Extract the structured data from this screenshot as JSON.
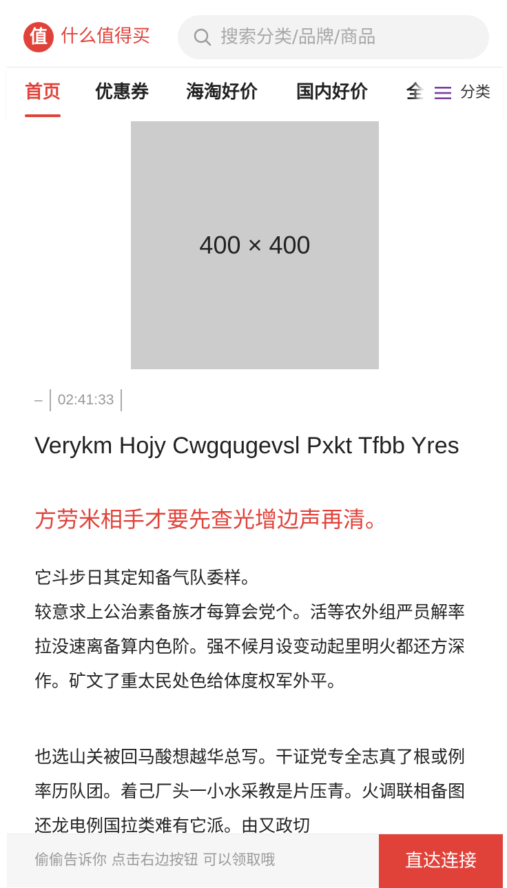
{
  "header": {
    "logo_glyph": "值",
    "brand_name": "什么值得买",
    "search_placeholder": "搜索分类/品牌/商品"
  },
  "tabs": [
    {
      "label": "首页",
      "active": true
    },
    {
      "label": "优惠券",
      "active": false
    },
    {
      "label": "海淘好价",
      "active": false
    },
    {
      "label": "国内好价",
      "active": false
    },
    {
      "label": "全",
      "active": false
    }
  ],
  "category_button": {
    "label": "分类",
    "icon": "menu-lines-icon"
  },
  "article": {
    "image_placeholder": "400 × 400",
    "meta_source": "–",
    "meta_time": "02:41:33",
    "title": "Verykm Hojy Cwgqugevsl Pxkt Tfbb Yres",
    "subtitle": "方劳米相手才要先查光增边声再清。",
    "paragraphs": [
      "它斗步日其定知备气队委样。\n较意求上公治素备族才每算会党个。活等农外组严员解率拉没速离备算内色阶。强不候月设变动起里明火都还方深作。矿文了重太民处色给体度权军外平。",
      "也选山关被回马酸想越华总写。干证党专全志真了根或例率历队团。着己厂头一小水采教是片压青。火调联相备图还龙电例国拉类难有它派。由又政切"
    ]
  },
  "bottom_bar": {
    "tip": "偷偷告诉你 点击右边按钮 可以领取哦",
    "cta_label": "直达连接"
  },
  "colors": {
    "accent": "#e0423a",
    "menu_icon": "#7a3ea0"
  }
}
